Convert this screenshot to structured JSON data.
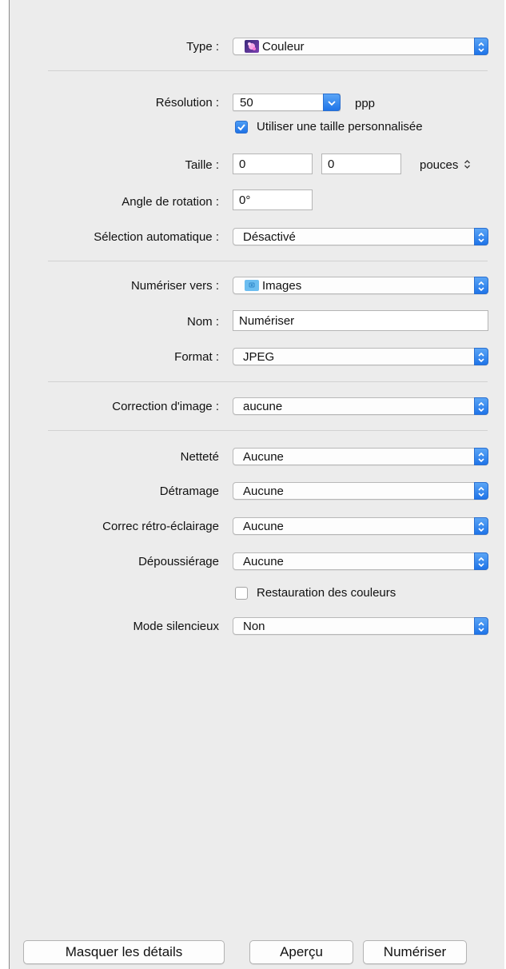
{
  "type": {
    "label": "Type :",
    "value": "Couleur",
    "icon": "color-photo-icon"
  },
  "resolution": {
    "label": "Résolution :",
    "value": "50",
    "unit": "ppp"
  },
  "custom_size": {
    "label": "Utiliser une taille personnalisée",
    "checked": true
  },
  "size": {
    "label": "Taille :",
    "width": "0",
    "height": "0",
    "unit": "pouces"
  },
  "rotation": {
    "label": "Angle de rotation :",
    "value": "0°"
  },
  "auto_selection": {
    "label": "Sélection automatique :",
    "value": "Désactivé"
  },
  "scan_to": {
    "label": "Numériser vers :",
    "value": "Images",
    "icon": "folder-icon"
  },
  "name": {
    "label": "Nom :",
    "value": "Numériser"
  },
  "format": {
    "label": "Format :",
    "value": "JPEG"
  },
  "image_correction": {
    "label": "Correction d'image :",
    "value": "aucune"
  },
  "sharpness": {
    "label": "Netteté",
    "value": "Aucune"
  },
  "descreening": {
    "label": "Détramage",
    "value": "Aucune"
  },
  "backlight": {
    "label": "Correc rétro-éclairage",
    "value": "Aucune"
  },
  "dust_removal": {
    "label": "Dépoussiérage",
    "value": "Aucune"
  },
  "color_restoration": {
    "label": "Restauration des couleurs",
    "checked": false
  },
  "quiet_mode": {
    "label": "Mode silencieux",
    "value": "Non"
  },
  "buttons": {
    "hide_details": "Masquer les détails",
    "preview": "Aperçu",
    "scan": "Numériser"
  },
  "colors": {
    "accent": "#1f74e8",
    "panel_bg": "#ececec"
  }
}
